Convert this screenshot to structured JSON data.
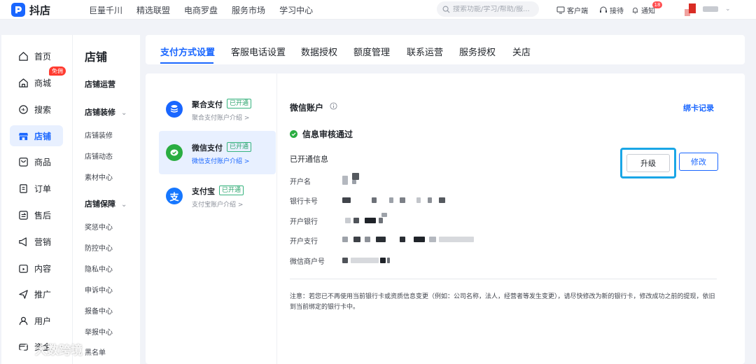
{
  "topbar": {
    "logo_text": "抖店",
    "nav": [
      "巨量千川",
      "精选联盟",
      "电商罗盘",
      "服务市场",
      "学习中心"
    ],
    "search_placeholder": "搜索功能/学习/帮助/服...",
    "client_label": "客户端",
    "reception_label": "接待",
    "notice_label": "通知",
    "notice_count": "18"
  },
  "sidebar": {
    "hot_badge": "免佣",
    "items": [
      {
        "label": "首页",
        "icon": "home-icon"
      },
      {
        "label": "商城",
        "icon": "mall-icon"
      },
      {
        "label": "搜索",
        "icon": "search-icon"
      },
      {
        "label": "店铺",
        "icon": "store-icon"
      },
      {
        "label": "商品",
        "icon": "product-icon"
      },
      {
        "label": "订单",
        "icon": "order-icon"
      },
      {
        "label": "售后",
        "icon": "after-sale-icon"
      },
      {
        "label": "营销",
        "icon": "megaphone-icon"
      },
      {
        "label": "内容",
        "icon": "play-icon"
      },
      {
        "label": "推广",
        "icon": "promote-icon"
      },
      {
        "label": "用户",
        "icon": "user-icon"
      },
      {
        "label": "资金",
        "icon": "funds-icon"
      }
    ]
  },
  "subsidebar": {
    "title": "店铺",
    "group_ops": "店铺运营",
    "group_decor": "店铺装修",
    "decor_items": [
      "店铺装修",
      "店铺动态",
      "素材中心"
    ],
    "group_guard": "店铺保障",
    "guard_items": [
      "奖惩中心",
      "防控中心",
      "隐私中心",
      "申诉中心",
      "报备中心",
      "举报中心",
      "黑名单"
    ]
  },
  "tabs": [
    "支付方式设置",
    "客服电话设置",
    "数据授权",
    "额度管理",
    "联系运营",
    "服务授权",
    "关店"
  ],
  "payments": [
    {
      "name": "聚合支付",
      "status": "已开通",
      "link": "聚合支付账户介绍 >"
    },
    {
      "name": "微信支付",
      "status": "已开通",
      "link": "微信支付账户介绍 >"
    },
    {
      "name": "支付宝",
      "status": "已开通",
      "link": "支付宝账户介绍 >"
    }
  ],
  "detail": {
    "title": "微信账户",
    "bind_record": "绑卡记录",
    "verified": "信息审核通过",
    "opened_info": "已开通信息",
    "upgrade": "升级",
    "modify": "修改",
    "fields": [
      "开户名",
      "银行卡号",
      "开户银行",
      "开户支行",
      "微信商户号"
    ],
    "note": "注意：若您已不再使用当前银行卡或资质信息变更（例如：公司名称，法人，经营者等发生变更），请尽快修改为新的银行卡，修改成功之前的提现，依旧到当前绑定的银行卡中。"
  },
  "colors": {
    "accent": "#1966ff",
    "success": "#2aa36b",
    "highlight": "#1aa6e6"
  },
  "watermark": "大数跨境"
}
